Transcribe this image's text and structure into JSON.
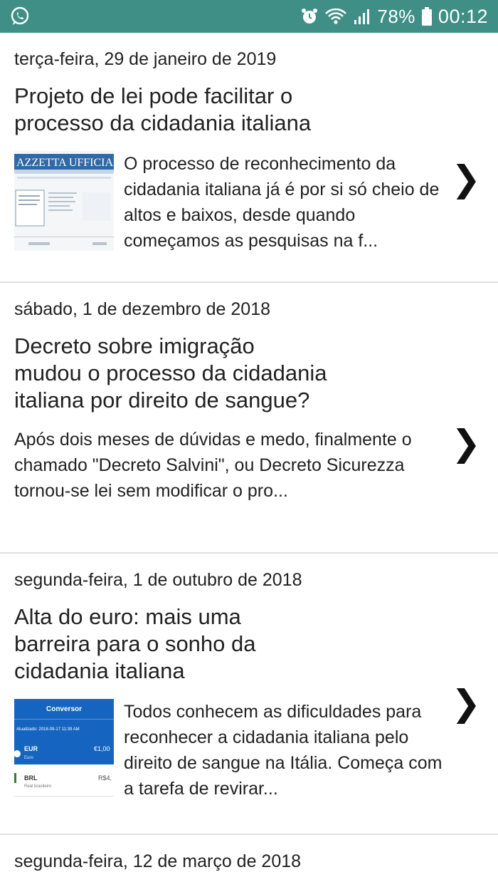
{
  "status_bar": {
    "battery": "78%",
    "time": "00:12",
    "icons": [
      "whatsapp-icon",
      "alarm-icon",
      "wifi-icon",
      "signal-icon",
      "battery-icon"
    ]
  },
  "posts": [
    {
      "date": "terça-feira, 29 de janeiro de 2019",
      "title": "Projeto de lei pode facilitar o processo da cidadania italiana",
      "excerpt": "O processo de reconhecimento da cidadania italiana já é por si só cheio de altos e baixos, desde quando começamos as pesquisas na f...",
      "thumb_text": "AZZETTA UFFICIAL"
    },
    {
      "date": "sábado, 1 de dezembro de 2018",
      "title": "Decreto sobre imigração mudou o processo da cidadania italiana por direito de sangue?",
      "excerpt": "Após dois meses de dúvidas e medo, finalmente o chamado \"Decreto Salvini\", ou Decreto Sicurezza tornou-se lei sem modificar o pro..."
    },
    {
      "date": "segunda-feira, 1 de outubro de 2018",
      "title": "Alta do euro: mais uma barreira para o sonho da cidadania italiana",
      "excerpt": "Todos conhecem as dificuldades para reconhecer a cidadania italiana pelo direito de sangue na Itália. Começa com a tarefa de revirar...",
      "thumb": {
        "header": "Conversor",
        "updated": "Atualizado: 2018-09-17 11:39 AM",
        "row1_code": "EUR",
        "row1_name": "Euro",
        "row1_value": "€1,00",
        "row2_code": "BRL",
        "row2_name": "Real brasileiro",
        "row2_value": "R$4,"
      }
    },
    {
      "date": "segunda-feira, 12 de março de 2018"
    }
  ],
  "chevron": "❯"
}
